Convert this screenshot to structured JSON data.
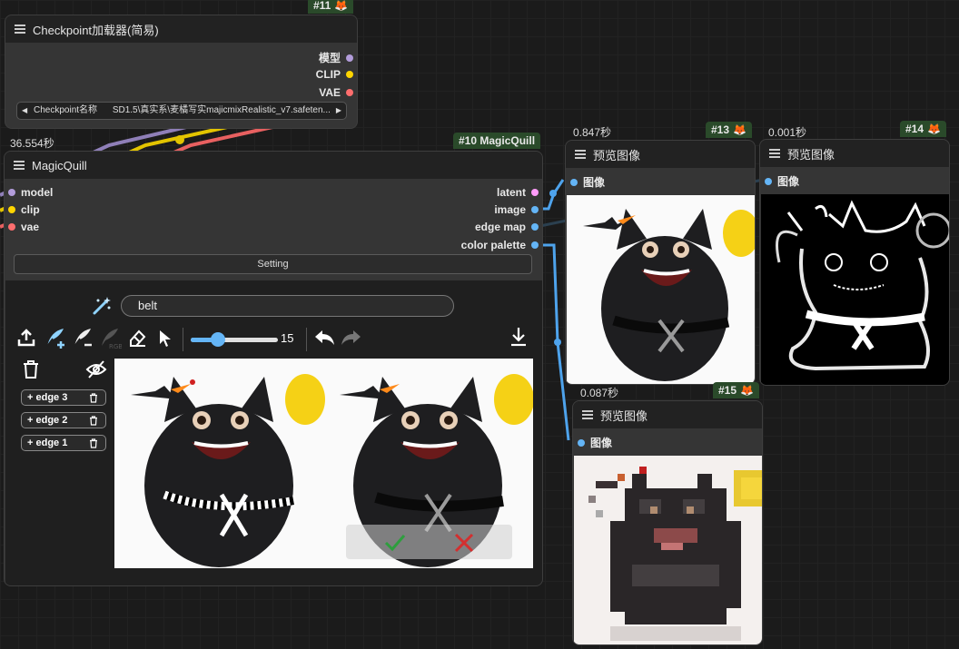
{
  "checkpoint_node": {
    "badge": "#11",
    "title": "Checkpoint加载器(简易)",
    "outputs": [
      "模型",
      "CLIP",
      "VAE"
    ],
    "widget_name": "Checkpoint名称",
    "widget_value": "SD1.5\\真实系\\麦橘写实majicmixRealistic_v7.safeten...",
    "time": "36.554秒"
  },
  "magicquill_node": {
    "badge": "#10 MagicQuill",
    "title": "MagicQuill",
    "inputs": [
      "model",
      "clip",
      "vae"
    ],
    "outputs": [
      "latent",
      "image",
      "edge map",
      "color palette"
    ],
    "setting_label": "Setting",
    "prompt_value": "belt",
    "brush_size": "15",
    "edges": [
      "+ edge 3",
      "+ edge 2",
      "+ edge 1"
    ]
  },
  "preview13": {
    "badge": "#13",
    "time": "0.847秒",
    "title": "预览图像",
    "input": "图像"
  },
  "preview14": {
    "badge": "#14",
    "time": "0.001秒",
    "title": "预览图像",
    "input": "图像"
  },
  "preview15": {
    "badge": "#15",
    "time": "0.087秒",
    "title": "预览图像",
    "input": "图像"
  },
  "colors": {
    "model_slot": "#b39ddb",
    "clip_slot": "#ffd500",
    "vae_slot": "#ff6e6e",
    "latent_slot": "#ff9cf9",
    "image_slot": "#64b5f6",
    "badge_bg": "#2a4a2a",
    "accept": "#2e9e3e",
    "reject": "#d32f2f"
  },
  "icons": [
    "hamburger-icon",
    "fox-icon",
    "magic-wand-icon",
    "upload-icon",
    "brush-add-icon",
    "brush-subtract-icon",
    "brush-color-icon",
    "eraser-icon",
    "pointer-icon",
    "undo-icon",
    "redo-icon",
    "download-icon",
    "trash-icon",
    "eye-off-icon",
    "check-icon",
    "cross-icon",
    "triangle-left-icon",
    "triangle-right-icon"
  ]
}
